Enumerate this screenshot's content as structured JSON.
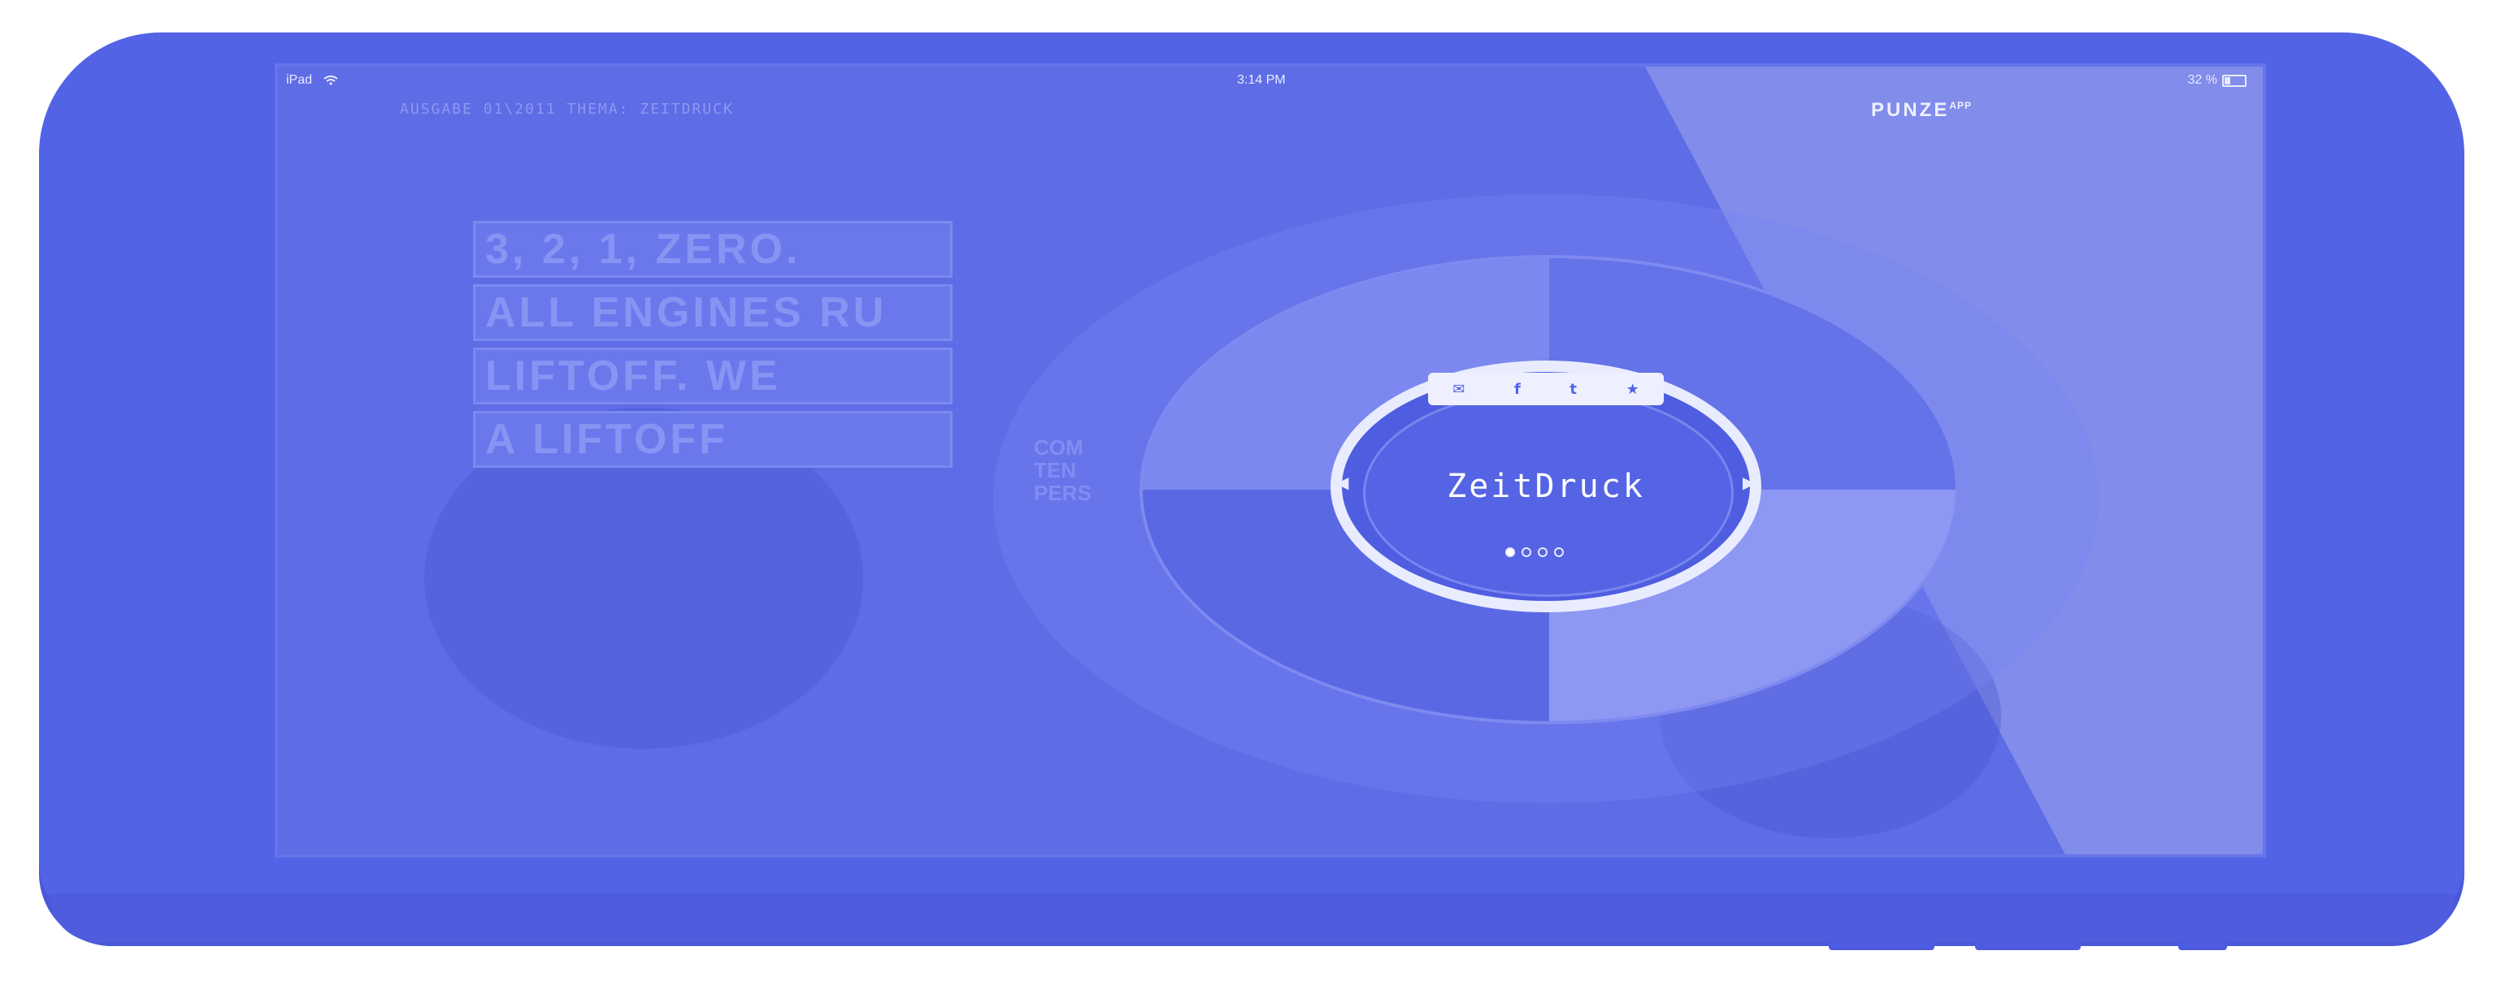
{
  "status_bar": {
    "device": "iPad",
    "wifi_icon": "wifi-icon",
    "time": "3:14 PM",
    "battery": "32 %",
    "battery_level": 0.32
  },
  "brand": {
    "name": "PUNZE",
    "suffix": "APP"
  },
  "issue_line": "AUSGABE 01\\2011   THEMA: ZEITDRUCK",
  "headline_rows": [
    "3, 2, 1, ZERO.",
    "ALL ENGINES RU",
    "LIFTOFF. WE",
    "A LIFTOFF"
  ],
  "side_text": [
    "COM",
    "TEN",
    "PERS"
  ],
  "carousel": {
    "title": "ZeitDruck",
    "share_icons": [
      "mail-icon",
      "facebook-icon",
      "twitter-icon",
      "star-icon"
    ],
    "page_count": 4,
    "active_page": 1
  },
  "colors": {
    "device": "#5363e6",
    "screen": "#5e6ce6",
    "accent": "#e9ecff"
  }
}
